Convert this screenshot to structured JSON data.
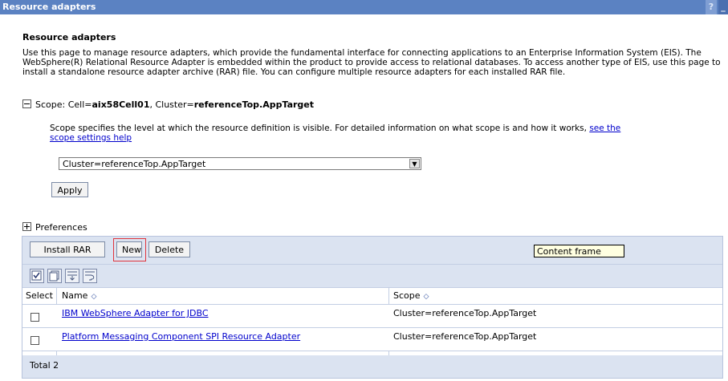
{
  "window": {
    "title": "Resource adapters",
    "help_glyph": "?",
    "min_glyph": "_"
  },
  "page": {
    "heading": "Resource adapters",
    "description": "Use this page to manage resource adapters, which provide the fundamental interface for connecting applications to an Enterprise Information System (EIS). The WebSphere(R) Relational Resource Adapter is embedded within the product to provide access to relational databases. To access another type of EIS, use this page to install a standalone resource adapter archive (RAR) file. You can configure multiple resource adapters for each installed RAR file."
  },
  "scope": {
    "label": "Scope: Cell=",
    "cell": "aix58Cell01",
    "sep": ", Cluster=",
    "cluster": "referenceTop.AppTarget",
    "help_text": "Scope specifies the level at which the resource definition is visible. For detailed information on what scope is and how it works, ",
    "help_link": "see the scope settings help",
    "selected": "Cluster=referenceTop.AppTarget",
    "apply_label": "Apply"
  },
  "preferences": {
    "label": "Preferences"
  },
  "toolbar": {
    "install_label": "Install RAR",
    "new_label": "New",
    "delete_label": "Delete",
    "tooltip": "Content frame",
    "icons": [
      "select-all-icon",
      "deselect-all-icon",
      "show-filter-icon",
      "clear-filter-icon"
    ]
  },
  "table": {
    "headers": {
      "select": "Select",
      "name": "Name",
      "scope": "Scope",
      "sort_glyph": "◇"
    },
    "rows": [
      {
        "name": "IBM WebSphere Adapter for JDBC",
        "scope": "Cluster=referenceTop.AppTarget"
      },
      {
        "name": "Platform Messaging Component SPI Resource Adapter",
        "scope": "Cluster=referenceTop.AppTarget"
      }
    ],
    "total_label": "Total 2"
  },
  "colors": {
    "title_bar": "#5b82c2",
    "panel_bg": "#dbe3f1",
    "link": "#0000cc",
    "highlight": "#e0343c"
  }
}
